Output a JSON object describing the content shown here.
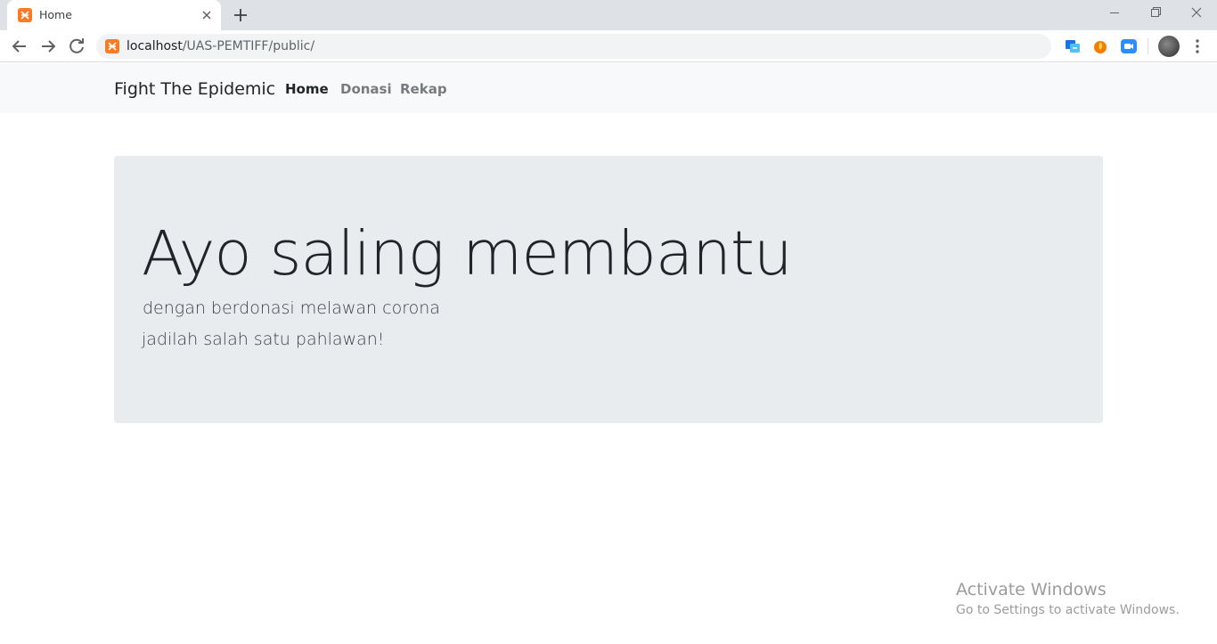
{
  "browser": {
    "tab": {
      "title": "Home",
      "favicon": "xampp-icon"
    },
    "address_bar": {
      "host": "localhost",
      "path": "/UAS-PEMTIFF/public/"
    },
    "extensions": [
      "translate-extension-icon",
      "fire-extension-icon",
      "zoom-extension-icon"
    ],
    "accent_color": "#fb7a24"
  },
  "navbar": {
    "brand": "Fight The Epidemic",
    "links": [
      {
        "label": "Home",
        "active": true
      },
      {
        "label": "Donasi",
        "active": false
      },
      {
        "label": "Rekap",
        "active": false
      }
    ]
  },
  "jumbotron": {
    "heading": "Ayo saling membantu",
    "line1": "dengan berdonasi melawan corona",
    "line2": "jadilah salah satu pahlawan!"
  },
  "watermark": {
    "title": "Activate Windows",
    "subtitle": "Go to Settings to activate Windows."
  }
}
